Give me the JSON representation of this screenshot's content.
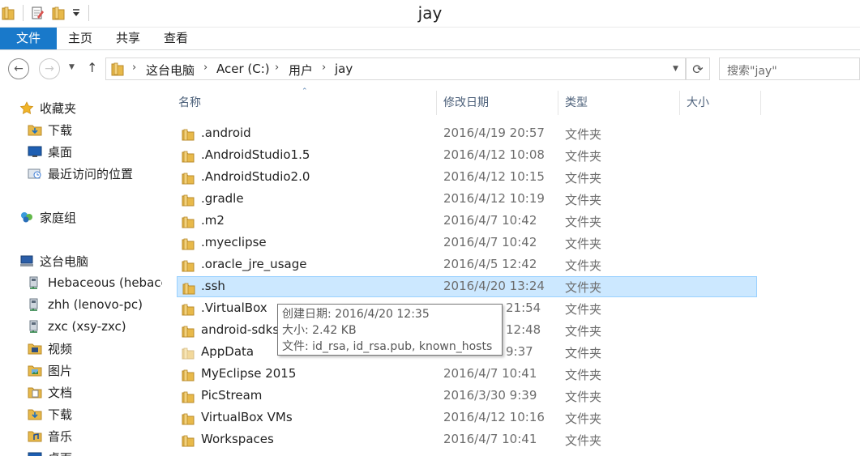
{
  "window": {
    "title": "jay"
  },
  "ribbon": {
    "tabs": [
      "文件",
      "主页",
      "共享",
      "查看"
    ]
  },
  "address": {
    "breadcrumbs": [
      "这台电脑",
      "Acer (C:)",
      "用户",
      "jay"
    ],
    "search_placeholder": "搜索\"jay\""
  },
  "nav": {
    "favorites_header": "收藏夹",
    "favorites": [
      "下载",
      "桌面",
      "最近访问的位置"
    ],
    "homegroup": "家庭组",
    "thispc_header": "这台电脑",
    "thispc": [
      "Hebaceous (hebace",
      "zhh (lenovo-pc)",
      "zxc (xsy-zxc)",
      "视频",
      "图片",
      "文档",
      "下载",
      "音乐",
      "桌面"
    ]
  },
  "columns": [
    "名称",
    "修改日期",
    "类型",
    "大小"
  ],
  "files": [
    {
      "name": ".android",
      "date": "2016/4/19 20:57",
      "type": "文件夹"
    },
    {
      "name": ".AndroidStudio1.5",
      "date": "2016/4/12 10:08",
      "type": "文件夹"
    },
    {
      "name": ".AndroidStudio2.0",
      "date": "2016/4/12 10:15",
      "type": "文件夹"
    },
    {
      "name": ".gradle",
      "date": "2016/4/12 10:19",
      "type": "文件夹"
    },
    {
      "name": ".m2",
      "date": "2016/4/7 10:42",
      "type": "文件夹"
    },
    {
      "name": ".myeclipse",
      "date": "2016/4/7 10:42",
      "type": "文件夹"
    },
    {
      "name": ".oracle_jre_usage",
      "date": "2016/4/5 12:42",
      "type": "文件夹"
    },
    {
      "name": ".ssh",
      "date": "2016/4/20 13:24",
      "type": "文件夹"
    },
    {
      "name": ".VirtualBox",
      "date": "21:54",
      "type": "文件夹"
    },
    {
      "name": "android-sdks",
      "date": "12:48",
      "type": "文件夹"
    },
    {
      "name": "AppData",
      "date": "9:37",
      "type": "文件夹"
    },
    {
      "name": "MyEclipse 2015",
      "date": "2016/4/7 10:41",
      "type": "文件夹"
    },
    {
      "name": "PicStream",
      "date": "2016/3/30 9:39",
      "type": "文件夹"
    },
    {
      "name": "VirtualBox VMs",
      "date": "2016/4/12 10:16",
      "type": "文件夹"
    },
    {
      "name": "Workspaces",
      "date": "2016/4/7 10:41",
      "type": "文件夹"
    }
  ],
  "tooltip": {
    "line1": "创建日期: 2016/4/20 12:35",
    "line2": "大小: 2.42 KB",
    "line3": "文件: id_rsa, id_rsa.pub, known_hosts"
  },
  "colors": {
    "accent": "#1979ca",
    "selection": "#cce8ff",
    "selection_border": "#99d1ff",
    "folder": "#e8b94a"
  }
}
